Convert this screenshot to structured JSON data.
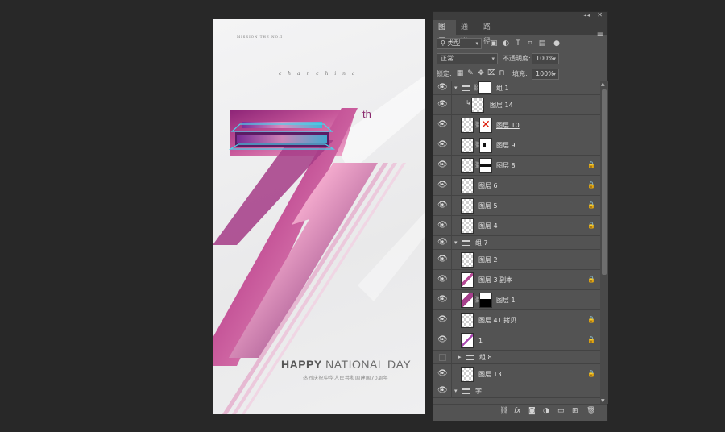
{
  "poster": {
    "top_text": "MISSION THE NO.1",
    "script_text": "c h a n  c h i n a",
    "th": "th",
    "happy_bold": "HAPPY",
    "happy_rest": "NATIONAL DAY",
    "subtitle": "热烈庆祝中华人民共和国建国70周年"
  },
  "panel": {
    "topbar_collapse": "◂◂",
    "topbar_close": "✕",
    "tabs": [
      "图层",
      "通道",
      "路径"
    ],
    "menu_icon": "≡",
    "filter_kind": "类型",
    "blend_mode": "正常",
    "opacity_label": "不透明度:",
    "opacity_value": "100%",
    "lock_label": "锁定:",
    "fill_label": "填充:",
    "fill_value": "100%",
    "layers": [
      {
        "name": "组 1",
        "kind": "group-open"
      },
      {
        "name": "图层 14",
        "kind": "layer"
      },
      {
        "name": "图层 10",
        "kind": "layer"
      },
      {
        "name": "图层 9",
        "kind": "layer"
      },
      {
        "name": "图层 8",
        "kind": "layer"
      },
      {
        "name": "图层 6",
        "kind": "layer"
      },
      {
        "name": "图层 5",
        "kind": "layer"
      },
      {
        "name": "图层 4",
        "kind": "layer"
      },
      {
        "name": "组 7",
        "kind": "group-open"
      },
      {
        "name": "图层 2",
        "kind": "layer"
      },
      {
        "name": "图层 3 副本",
        "kind": "layer"
      },
      {
        "name": "图层 1",
        "kind": "layer"
      },
      {
        "name": "图层 41 拷贝",
        "kind": "layer"
      },
      {
        "name": "1",
        "kind": "layer"
      },
      {
        "name": "组 8",
        "kind": "group-closed"
      },
      {
        "name": "图层 13",
        "kind": "layer"
      },
      {
        "name": "字",
        "kind": "group-open"
      }
    ]
  },
  "colors": {
    "accent_purple": "#7a1f6b",
    "accent_pink": "#ef9ac4",
    "accent_cyan": "#1fd4e0",
    "panel_bg": "#535353",
    "canvas_bg": "#282828"
  }
}
